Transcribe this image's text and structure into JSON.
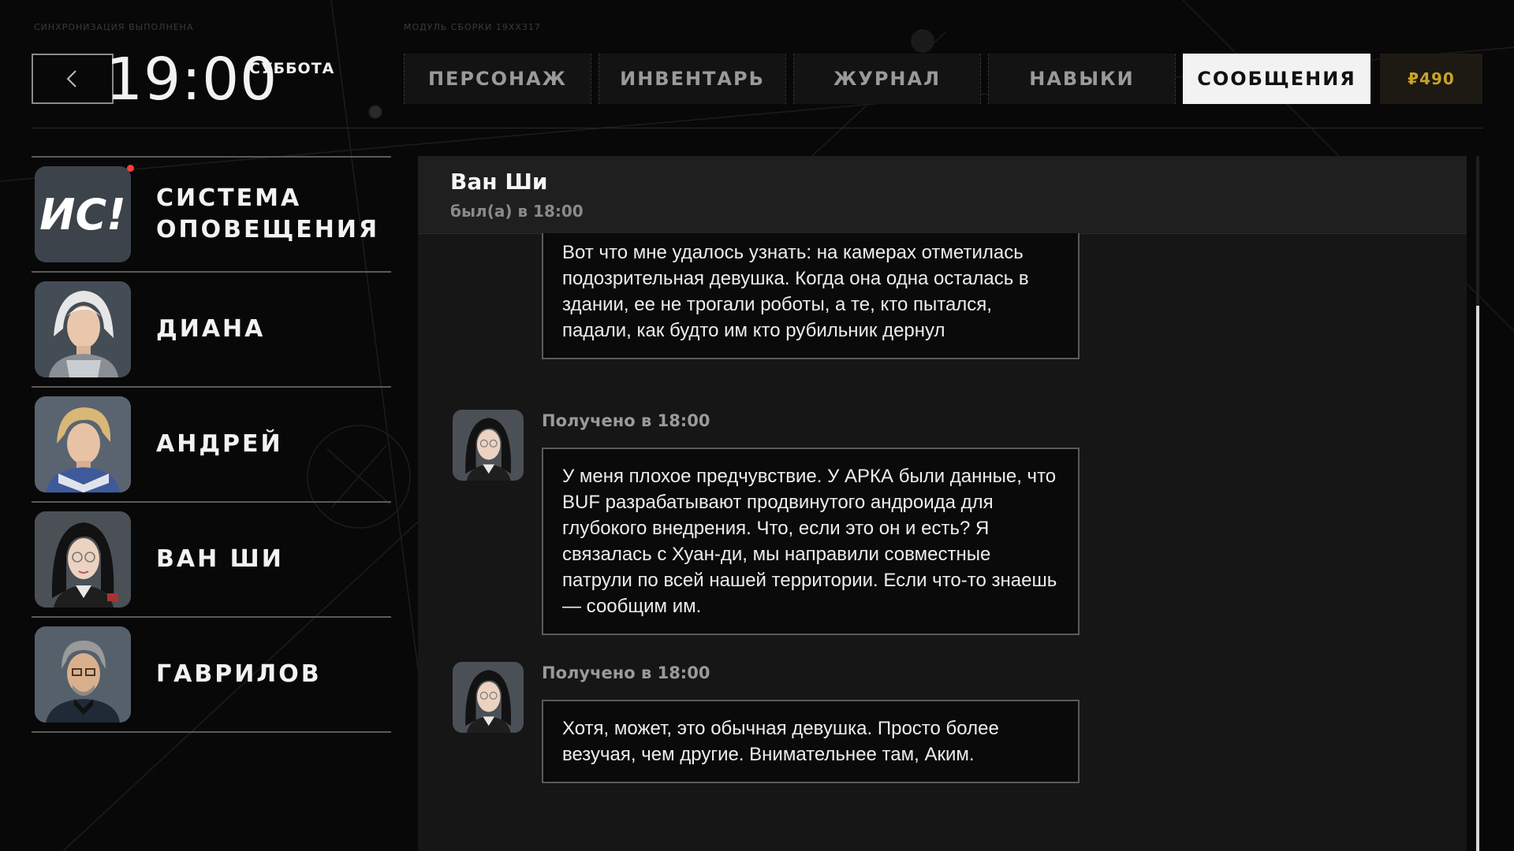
{
  "meta": {
    "sync_status": "Синхронизация выполнена",
    "build_info": "Модуль сборки 19xx317"
  },
  "header": {
    "time": "19:00",
    "weekday": "СУББОТА"
  },
  "tabs": [
    {
      "label": "ПЕРСОНАЖ",
      "active": false
    },
    {
      "label": "ИНВЕНТАРЬ",
      "active": false
    },
    {
      "label": "ЖУРНАЛ",
      "active": false
    },
    {
      "label": "НАВЫКИ",
      "active": false
    },
    {
      "label": "СООБЩЕНИЯ",
      "active": true
    }
  ],
  "currency": {
    "label": "₽490",
    "color": "#c9a227"
  },
  "contacts": [
    {
      "name": "СИСТЕМА ОПОВЕЩЕНИЯ",
      "avatar": "alert-system-logo",
      "logo_text": "ИС!",
      "unread": true
    },
    {
      "name": "ДИАНА",
      "avatar": "diana-portrait",
      "unread": false
    },
    {
      "name": "АНДРЕЙ",
      "avatar": "andrey-portrait",
      "unread": false
    },
    {
      "name": "ВАН ШИ",
      "avatar": "van-shi-portrait",
      "unread": false
    },
    {
      "name": "ГАВРИЛОВ",
      "avatar": "gavrilov-portrait",
      "unread": false
    }
  ],
  "chat": {
    "contact_name": "Ван Ши",
    "status": "был(а) в 18:00",
    "messages": [
      {
        "received": "",
        "text": "Вот что мне удалось узнать: на камерах отметилась подозрительная девушка. Когда она одна осталась в здании, ее не трогали роботы, а те, кто пытался, падали, как будто им кто рубильник дернул"
      },
      {
        "received": "Получено в 18:00",
        "text": "У меня плохое предчувствие. У АРКА были данные, что BUF разрабатывают продвинутого андроида для глубокого внедрения. Что, если это он и есть?  Я связалась с Хуан-ди, мы направили совместные патрули по всей нашей территории. Если что-то знаешь — сообщим им."
      },
      {
        "received": "Получено в 18:00",
        "text": "Хотя, может, это обычная девушка. Просто более везучая, чем другие. Внимательнее там, Аким."
      }
    ]
  },
  "colors": {
    "accent_gold": "#c9a227",
    "unread_dot": "#ff3b3b",
    "active_tab_bg": "#f2f2f2"
  }
}
